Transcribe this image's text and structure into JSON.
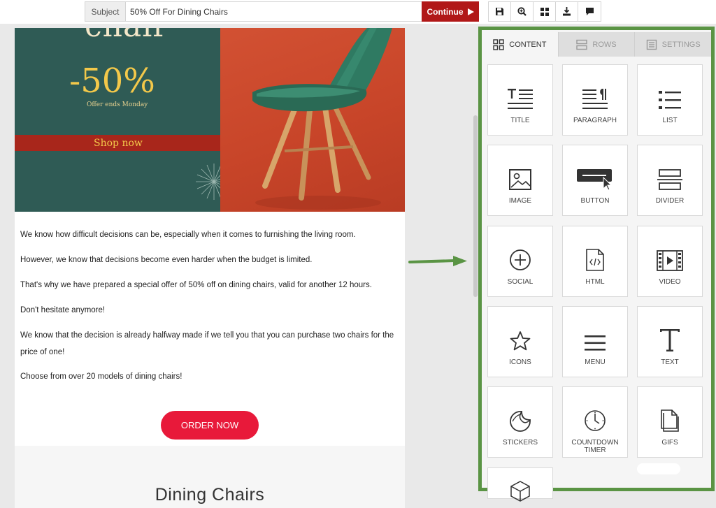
{
  "topbar": {
    "subject_label": "Subject",
    "subject_value": "50% Off For Dining Chairs",
    "continue_label": "Continue",
    "tools": [
      "save-icon",
      "zoom-in-icon",
      "grid-icon",
      "download-icon",
      "comment-icon"
    ]
  },
  "hero": {
    "word": "chair",
    "discount": "-50%",
    "offer": "Offer ends Monday",
    "shop": "Shop now"
  },
  "email": {
    "paragraphs": [
      "We know how difficult decisions can be, especially when it comes to furnishing the living room.",
      "However, we know that decisions become even harder when the budget is limited.",
      "That's why we have prepared a special offer of 50% off on dining chairs, valid for another 12 hours.",
      "Don't hesitate anymore!",
      "We know that the decision is already halfway made if we tell you that you can purchase two chairs for the price of one!",
      "Choose from over 20 models of dining chairs!"
    ],
    "order_button": "ORDER NOW",
    "section_title": "Dining Chairs"
  },
  "panel": {
    "tabs": [
      {
        "label": "CONTENT",
        "icon": "content-grid-icon",
        "active": true
      },
      {
        "label": "ROWS",
        "icon": "rows-icon",
        "active": false
      },
      {
        "label": "SETTINGS",
        "icon": "settings-icon",
        "active": false
      }
    ],
    "tiles": [
      {
        "label": "TITLE",
        "icon": "title-icon"
      },
      {
        "label": "PARAGRAPH",
        "icon": "paragraph-icon"
      },
      {
        "label": "LIST",
        "icon": "list-icon"
      },
      {
        "label": "IMAGE",
        "icon": "image-icon"
      },
      {
        "label": "BUTTON",
        "icon": "button-icon"
      },
      {
        "label": "DIVIDER",
        "icon": "divider-icon"
      },
      {
        "label": "SOCIAL",
        "icon": "social-icon"
      },
      {
        "label": "HTML",
        "icon": "html-icon"
      },
      {
        "label": "VIDEO",
        "icon": "video-icon"
      },
      {
        "label": "ICONS",
        "icon": "star-icon"
      },
      {
        "label": "MENU",
        "icon": "menu-icon"
      },
      {
        "label": "TEXT",
        "icon": "text-icon"
      },
      {
        "label": "STICKERS",
        "icon": "sticker-icon"
      },
      {
        "label": "COUNTDOWN TIMER",
        "icon": "clock-icon"
      },
      {
        "label": "GIFS",
        "icon": "gif-file-icon"
      },
      {
        "label": "",
        "icon": "cube-icon"
      }
    ]
  },
  "colors": {
    "accent_red": "#b11818",
    "order_button": "#e8193a",
    "annotation_green": "#5a9444",
    "hero_green": "#2f5b55"
  }
}
